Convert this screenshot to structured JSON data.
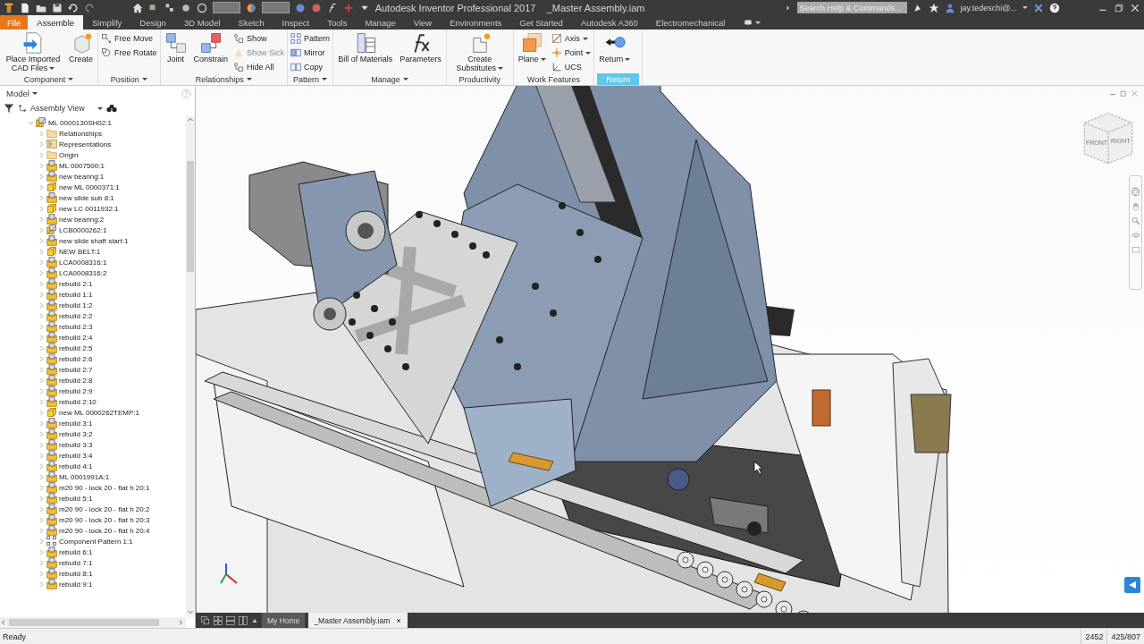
{
  "title_bar": {
    "app_title": "Autodesk Inventor Professional 2017",
    "document_title": "_Master Assembly.iam",
    "search": {
      "placeholder": "Search Help & Commands..."
    },
    "user": "jay.tedeschi@..."
  },
  "ribbon_tabs": [
    {
      "label": "File",
      "kind": "application",
      "selected": false
    },
    {
      "label": "Assemble",
      "kind": "tab",
      "selected": true
    },
    {
      "label": "Simplify",
      "kind": "tab",
      "selected": false
    },
    {
      "label": "Design",
      "kind": "tab",
      "selected": false
    },
    {
      "label": "3D Model",
      "kind": "tab",
      "selected": false
    },
    {
      "label": "Sketch",
      "kind": "tab",
      "selected": false
    },
    {
      "label": "Inspect",
      "kind": "tab",
      "selected": false
    },
    {
      "label": "Tools",
      "kind": "tab",
      "selected": false
    },
    {
      "label": "Manage",
      "kind": "tab",
      "selected": false
    },
    {
      "label": "View",
      "kind": "tab",
      "selected": false
    },
    {
      "label": "Environments",
      "kind": "tab",
      "selected": false
    },
    {
      "label": "Get Started",
      "kind": "tab",
      "selected": false
    },
    {
      "label": "Autodesk A360",
      "kind": "tab",
      "selected": false
    },
    {
      "label": "Electromechanical",
      "kind": "tab",
      "selected": false
    }
  ],
  "ribbon_panels": [
    {
      "label": "Component",
      "dropdown": true,
      "highlighted": false,
      "tools": [
        {
          "label": "Place Imported CAD Files",
          "kind": "large",
          "dropdown": true,
          "disabled": false
        },
        {
          "label": "Create",
          "kind": "large",
          "dropdown": false,
          "disabled": false
        }
      ]
    },
    {
      "label": "Position",
      "dropdown": true,
      "highlighted": false,
      "tools": [
        {
          "label": "Free Move",
          "kind": "small",
          "dropdown": false,
          "disabled": false
        },
        {
          "label": "Free Rotate",
          "kind": "small",
          "dropdown": false,
          "disabled": false
        }
      ]
    },
    {
      "label": "Relationships",
      "dropdown": true,
      "highlighted": false,
      "tools": [
        {
          "label": "Joint",
          "kind": "large",
          "dropdown": false,
          "disabled": false
        },
        {
          "label": "Constrain",
          "kind": "large",
          "dropdown": false,
          "disabled": false
        },
        {
          "label": "Show",
          "kind": "small",
          "dropdown": false,
          "disabled": false
        },
        {
          "label": "Show Sick",
          "kind": "small",
          "dropdown": false,
          "disabled": true
        },
        {
          "label": "Hide All",
          "kind": "small",
          "dropdown": false,
          "disabled": false
        }
      ]
    },
    {
      "label": "Pattern",
      "dropdown": true,
      "highlighted": false,
      "tools": [
        {
          "label": "Pattern",
          "kind": "small",
          "dropdown": false,
          "disabled": false
        },
        {
          "label": "Mirror",
          "kind": "small",
          "dropdown": false,
          "disabled": false
        },
        {
          "label": "Copy",
          "kind": "small",
          "dropdown": false,
          "disabled": false
        }
      ]
    },
    {
      "label": "Manage",
      "dropdown": true,
      "highlighted": false,
      "tools": [
        {
          "label": "Bill of Materials",
          "kind": "large",
          "dropdown": false,
          "disabled": false
        },
        {
          "label": "Parameters",
          "kind": "large",
          "dropdown": false,
          "disabled": false
        }
      ]
    },
    {
      "label": "Productivity",
      "dropdown": false,
      "highlighted": false,
      "tools": [
        {
          "label": "Create Substitutes",
          "kind": "large",
          "dropdown": true,
          "disabled": false
        }
      ]
    },
    {
      "label": "Work Features",
      "dropdown": false,
      "highlighted": false,
      "tools": [
        {
          "label": "Plane",
          "kind": "large",
          "dropdown": true,
          "disabled": false
        },
        {
          "label": "Axis",
          "kind": "small",
          "dropdown": true,
          "disabled": false
        },
        {
          "label": "Point",
          "kind": "small",
          "dropdown": true,
          "disabled": false
        },
        {
          "label": "UCS",
          "kind": "small",
          "dropdown": false,
          "disabled": false
        }
      ]
    },
    {
      "label": "Return",
      "dropdown": false,
      "highlighted": true,
      "tools": [
        {
          "label": "Return",
          "kind": "large",
          "dropdown": true,
          "disabled": false
        }
      ]
    }
  ],
  "browser": {
    "title": "Model",
    "view": "Assembly View",
    "tree": [
      {
        "label": "ML 0000130SH02:1",
        "kind": "assembly",
        "expanded": true,
        "children": [
          {
            "label": "Relationships",
            "kind": "folder",
            "expanded": false
          },
          {
            "label": "Representations",
            "kind": "representations",
            "expanded": false
          },
          {
            "label": "Origin",
            "kind": "folder",
            "expanded": false
          },
          {
            "label": "ML 0007500:1",
            "kind": "subassembly",
            "expanded": false
          },
          {
            "label": "new bearing:1",
            "kind": "subassembly",
            "expanded": false
          },
          {
            "label": "new ML 0000371:1",
            "kind": "part",
            "expanded": false
          },
          {
            "label": "new slide sub 8:1",
            "kind": "subassembly",
            "expanded": false
          },
          {
            "label": "new LC 0011932:1",
            "kind": "part",
            "expanded": false
          },
          {
            "label": "new bearing:2",
            "kind": "subassembly",
            "expanded": false
          },
          {
            "label": "LCB0000262:1",
            "kind": "assembly",
            "expanded": false
          },
          {
            "label": "new slide shaft start:1",
            "kind": "subassembly",
            "expanded": false
          },
          {
            "label": "NEW BELT:1",
            "kind": "part",
            "expanded": false
          },
          {
            "label": "LCA0008316:1",
            "kind": "subassembly",
            "expanded": false
          },
          {
            "label": "LCA0008316:2",
            "kind": "subassembly",
            "expanded": false
          },
          {
            "label": "rebuild 2:1",
            "kind": "subassembly",
            "expanded": false
          },
          {
            "label": "rebuild 1:1",
            "kind": "subassembly",
            "expanded": false
          },
          {
            "label": "rebuild 1:2",
            "kind": "subassembly",
            "expanded": false
          },
          {
            "label": "rebuild 2:2",
            "kind": "subassembly",
            "expanded": false
          },
          {
            "label": "rebuild 2:3",
            "kind": "subassembly",
            "expanded": false
          },
          {
            "label": "rebuild 2:4",
            "kind": "subassembly",
            "expanded": false
          },
          {
            "label": "rebuild 2:5",
            "kind": "subassembly",
            "expanded": false
          },
          {
            "label": "rebuild 2:6",
            "kind": "subassembly",
            "expanded": false
          },
          {
            "label": "rebuild 2:7",
            "kind": "subassembly",
            "expanded": false
          },
          {
            "label": "rebuild 2:8",
            "kind": "subassembly",
            "expanded": false
          },
          {
            "label": "rebuild 2:9",
            "kind": "subassembly",
            "expanded": false
          },
          {
            "label": "rebuild 2:10",
            "kind": "subassembly",
            "expanded": false
          },
          {
            "label": "new ML 0000262TEMP:1",
            "kind": "part",
            "expanded": false
          },
          {
            "label": "rebuild 3:1",
            "kind": "subassembly",
            "expanded": false
          },
          {
            "label": "rebuild 3:2",
            "kind": "subassembly",
            "expanded": false
          },
          {
            "label": "rebuild 3:3",
            "kind": "subassembly",
            "expanded": false
          },
          {
            "label": "rebuild 3:4",
            "kind": "subassembly",
            "expanded": false
          },
          {
            "label": "rebuild 4:1",
            "kind": "subassembly",
            "expanded": false
          },
          {
            "label": "ML 0001991A:1",
            "kind": "subassembly",
            "expanded": false
          },
          {
            "label": "m20 90 - lock 20 - flat h 20:1",
            "kind": "subassembly",
            "expanded": false
          },
          {
            "label": "rebuild 5:1",
            "kind": "subassembly",
            "expanded": false
          },
          {
            "label": "m20 90 - lock 20 - flat h 20:2",
            "kind": "subassembly",
            "expanded": false
          },
          {
            "label": "m20 90 - lock 20 - flat h 20:3",
            "kind": "subassembly",
            "expanded": false
          },
          {
            "label": "m20 90 - lock 20 - flat h 20:4",
            "kind": "subassembly",
            "expanded": false
          },
          {
            "label": "Component Pattern 1:1",
            "kind": "pattern",
            "expanded": false
          },
          {
            "label": "rebuild 6:1",
            "kind": "subassembly",
            "expanded": false
          },
          {
            "label": "rebuild 7:1",
            "kind": "subassembly",
            "expanded": false
          },
          {
            "label": "rebuild 8:1",
            "kind": "subassembly",
            "expanded": false
          },
          {
            "label": "rebuild 9:1",
            "kind": "subassembly",
            "expanded": false
          }
        ]
      }
    ]
  },
  "viewport": {
    "view_cube": {
      "faces": [
        "FRONT",
        "RIGHT"
      ]
    }
  },
  "document_tabs": [
    {
      "label": "My Home",
      "selected": false,
      "closable": false
    },
    {
      "label": "_Master Assembly.iam",
      "selected": true,
      "closable": true
    }
  ],
  "status_bar": {
    "message": "Ready",
    "fields": [
      "2452",
      "425/807"
    ]
  }
}
